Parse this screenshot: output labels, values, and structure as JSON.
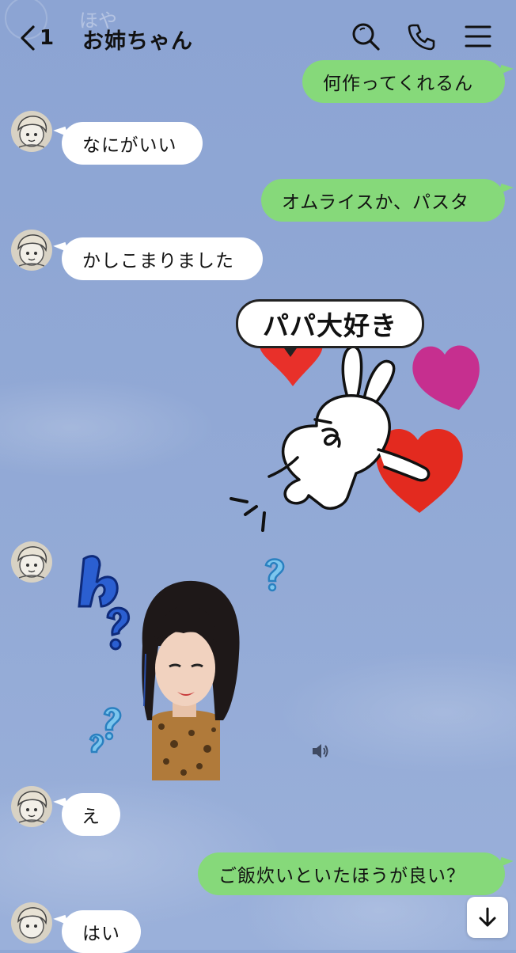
{
  "header": {
    "unread_count": "1",
    "chat_title": "お姉ちゃん",
    "ghost_text": "ほや"
  },
  "messages": [
    {
      "direction": "outgoing",
      "text": "何作ってくれるん"
    },
    {
      "direction": "incoming",
      "text": "なにがいい"
    },
    {
      "direction": "outgoing",
      "text": "オムライスか、パスタ"
    },
    {
      "direction": "incoming",
      "text": "かしこまりました"
    },
    {
      "direction": "outgoing",
      "type": "sticker",
      "sticker_text": "パパ大好き"
    },
    {
      "direction": "incoming",
      "type": "sticker",
      "sticker_text": "ん？"
    },
    {
      "direction": "incoming",
      "text": "え"
    },
    {
      "direction": "outgoing",
      "text": "ご飯炊いといたほうが良い？"
    },
    {
      "direction": "incoming",
      "text": "はい"
    }
  ],
  "colors": {
    "background": "#8fa7d4",
    "outgoing_bubble": "#86d97a",
    "incoming_bubble": "#ffffff"
  },
  "icons": {
    "back": "chevron-left-icon",
    "search": "search-icon",
    "call": "phone-icon",
    "menu": "hamburger-menu-icon",
    "sound": "speaker-icon",
    "scroll_down": "arrow-down-icon"
  }
}
